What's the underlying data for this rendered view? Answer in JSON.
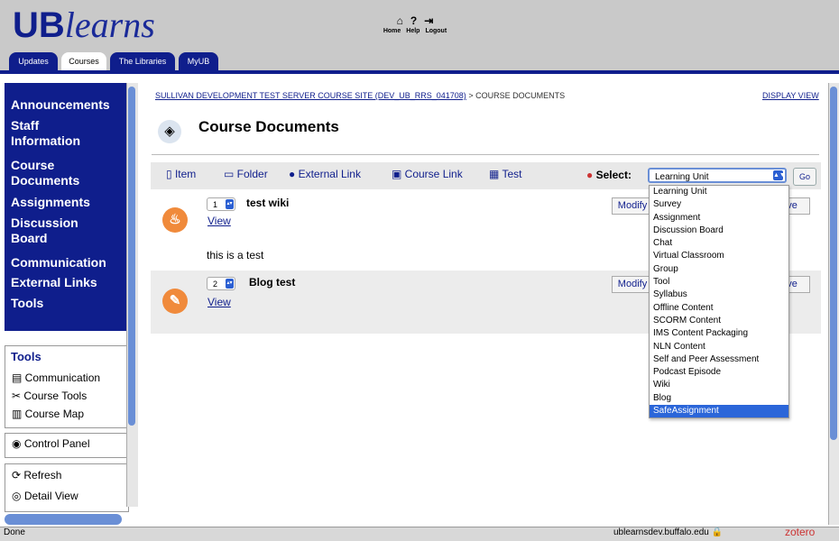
{
  "header": {
    "logo_ub": "UB",
    "logo_learns": "learns",
    "top_icons": [
      "home-icon",
      "help-icon",
      "logout-icon"
    ],
    "top_links": [
      "Home",
      "Help",
      "Logout"
    ],
    "tabs": [
      "Updates",
      "Courses",
      "The Libraries",
      "MyUB"
    ],
    "active_tab": "Courses"
  },
  "sidebar": {
    "nav": [
      "Announcements",
      "Staff Information",
      "Course Documents",
      "Assignments",
      "Discussion Board",
      "Communication",
      "External Links",
      "Tools"
    ],
    "tools_title": "Tools",
    "tools": [
      "Communication",
      "Course Tools",
      "Course Map"
    ],
    "control_panel": "Control Panel",
    "refresh": "Refresh",
    "detail_view": "Detail View"
  },
  "main": {
    "breadcrumb_link": "SULLIVAN DEVELOPMENT TEST SERVER COURSE SITE (DEV_UB_RRS_041708)",
    "breadcrumb_current": "> COURSE DOCUMENTS",
    "display_view": "DISPLAY VIEW",
    "page_title": "Course Documents",
    "actions": [
      "Item",
      "Folder",
      "External Link",
      "Course Link",
      "Test"
    ],
    "select_label": "Select:",
    "select_value": "Learning Unit",
    "go_label": "Go",
    "dropdown_options": [
      "Learning Unit",
      "Survey",
      "Assignment",
      "Discussion Board",
      "Chat",
      "Virtual Classroom",
      "Group",
      "Tool",
      "Syllabus",
      "Offline Content",
      "SCORM Content",
      "IMS Content Packaging",
      "NLN Content",
      "Self and Peer Assessment",
      "Podcast Episode",
      "Wiki",
      "Blog",
      "SafeAssignment"
    ],
    "dropdown_selected": "SafeAssignment",
    "items": [
      {
        "order": "1",
        "title": "test wiki",
        "view": "View",
        "body": "this is a test",
        "modify": "Modify",
        "remove": "ove"
      },
      {
        "order": "2",
        "title": "Blog test",
        "view": "View",
        "body": "",
        "modify": "Modify",
        "remove": "ove"
      }
    ]
  },
  "status": {
    "left": "Done",
    "host": "ublearnsdev.buffalo.edu",
    "zotero": "zotero"
  },
  "colors": {
    "brand": "#0f1e8c",
    "item_icon": "#f08a3b",
    "selection": "#2b66d9"
  }
}
